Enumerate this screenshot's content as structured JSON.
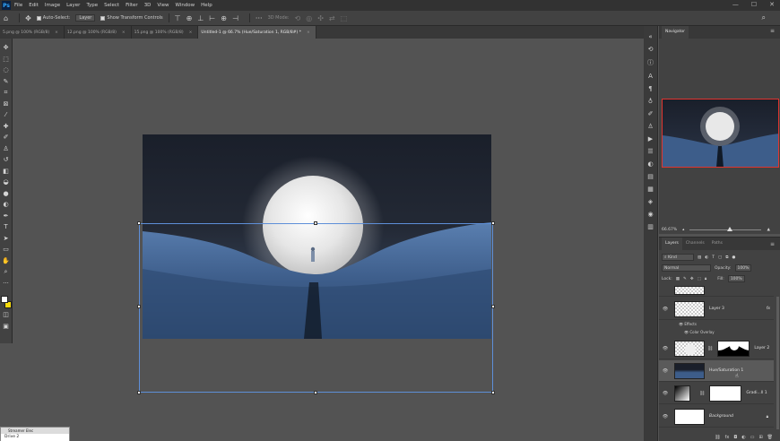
{
  "menubar": {
    "logo": "Ps",
    "items": [
      "File",
      "Edit",
      "Image",
      "Layer",
      "Type",
      "Select",
      "Filter",
      "3D",
      "View",
      "Window",
      "Help"
    ],
    "window_controls": [
      "—",
      "☐",
      "✕"
    ]
  },
  "options_bar": {
    "auto_select_label": "Auto-Select:",
    "auto_select_value": "Layer",
    "show_transform_label": "Show Transform Controls",
    "three_d_mode": "3D Mode:"
  },
  "tabs": [
    {
      "label": "5.png @ 100% (RGB/8)",
      "active": false
    },
    {
      "label": "12.png @ 100% (RGB/8)",
      "active": false
    },
    {
      "label": "15.png @ 100% (RGB/8)",
      "active": false
    },
    {
      "label": "Untitled-1 @ 66.7% (Hue/Saturation 1, RGB/8#) *",
      "active": true
    }
  ],
  "navigator": {
    "tab": "Navigator",
    "zoom": "66.67%"
  },
  "layers_panel": {
    "tabs": [
      "Layers",
      "Channels",
      "Paths"
    ],
    "kind": "Kind",
    "blend_mode": "Normal",
    "opacity_label": "Opacity:",
    "opacity_value": "100%",
    "lock_label": "Lock:",
    "fill_label": "Fill:",
    "fill_value": "100%",
    "layers": [
      {
        "name": "Layer 3",
        "fx": "fx"
      },
      {
        "name": "Effects"
      },
      {
        "name": "Color Overlay"
      },
      {
        "name": "Layer 2"
      },
      {
        "name": "Hue/Saturation 1"
      },
      {
        "name": "Gradi...ll 1"
      },
      {
        "name": "Background"
      }
    ]
  },
  "mini_panel": {
    "title": "Streamer Elec",
    "body": "Drive 2"
  },
  "colors": {
    "foreground": "#ffffff",
    "background": "#f5d90a",
    "selection_border": "#5e8fd8",
    "navigator_frame": "#e0342e"
  }
}
